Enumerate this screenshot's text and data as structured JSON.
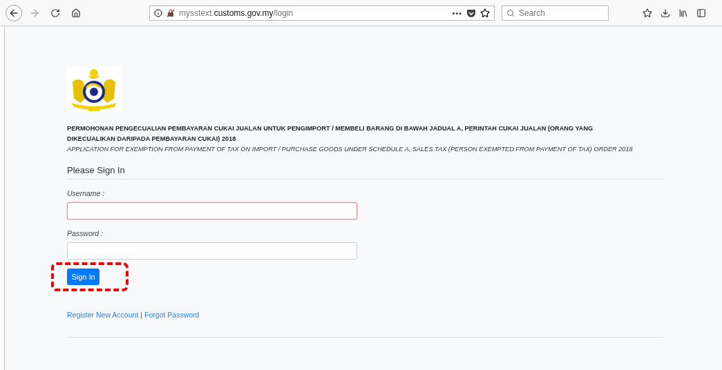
{
  "browser": {
    "url": {
      "before": "mysstext.",
      "domain": "customs.gov.my",
      "after": "/login"
    },
    "more": "•••",
    "search": {
      "placeholder": "Search"
    }
  },
  "page": {
    "title": "PERMOHONAN PENGECUALIAN PEMBAYARAN CUKAI JUALAN UNTUK PENGIMPORT / MEMBELI BARANG DI BAWAH JADUAL A, PERINTAH CUKAI JUALAN (ORANG YANG DIKECUALIKAN DARIPADA PEMBAYARAN CUKAI) 2018",
    "subtitle": "APPLICATION FOR EXEMPTION FROM PAYMENT OF TAX ON IMPORT / PURCHASE GOODS UNDER SCHEDULE A, SALES TAX (PERSON EXEMPTED FROM PAYMENT OF TAX) ORDER 2018",
    "heading": "Please Sign In",
    "fields": [
      {
        "label": "Username :",
        "invalid": true
      },
      {
        "label": "Password :",
        "invalid": false
      }
    ],
    "button": {
      "label": "Sign In",
      "highlighted": true
    },
    "links": [
      {
        "label": "Register New Account"
      },
      {
        "label": "Forgot Password"
      }
    ],
    "link_separator": "|"
  }
}
